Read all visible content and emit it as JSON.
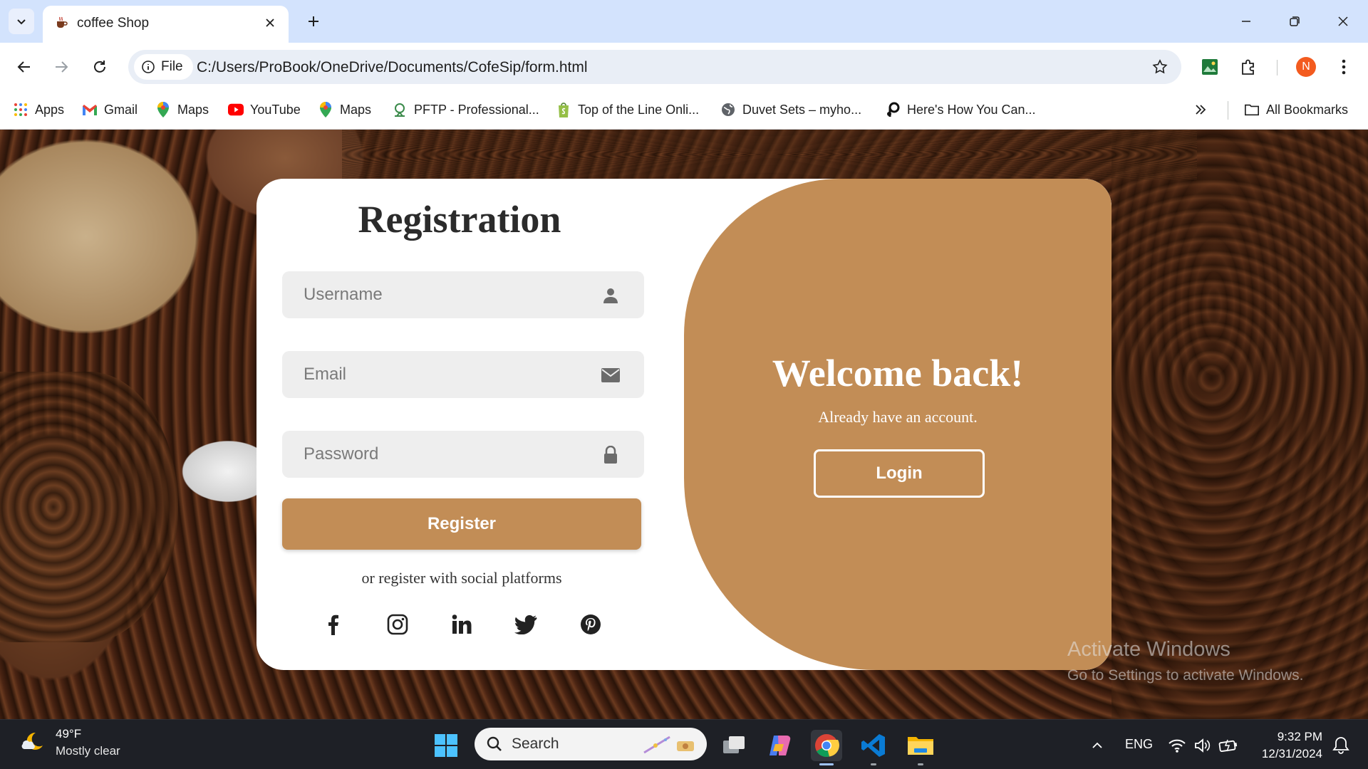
{
  "browser": {
    "tab": {
      "title": "coffee Shop"
    },
    "address": {
      "chip_label": "File",
      "url": "C:/Users/ProBook/OneDrive/Documents/CofeSip/form.html"
    },
    "profile_initial": "N",
    "bookmarks": [
      {
        "label": "Apps",
        "icon": "apps-grid-icon"
      },
      {
        "label": "Gmail",
        "icon": "gmail-icon"
      },
      {
        "label": "Maps",
        "icon": "maps-pin-icon"
      },
      {
        "label": "YouTube",
        "icon": "youtube-icon"
      },
      {
        "label": "Maps",
        "icon": "maps-pin-icon"
      },
      {
        "label": "PFTP - Professional...",
        "icon": "pftp-icon"
      },
      {
        "label": "Top of the Line Onli...",
        "icon": "shopify-bag-icon"
      },
      {
        "label": "Duvet Sets – myho...",
        "icon": "globe-icon"
      },
      {
        "label": "Here's How You Can...",
        "icon": "p-logo-icon"
      }
    ],
    "all_bookmarks": "All Bookmarks"
  },
  "form": {
    "title": "Registration",
    "username_placeholder": "Username",
    "email_placeholder": "Email",
    "password_placeholder": "Password",
    "register_label": "Register",
    "social_text": "or register with social platforms",
    "socials": [
      "facebook-icon",
      "instagram-icon",
      "linkedin-icon",
      "twitter-icon",
      "pinterest-icon"
    ]
  },
  "panel": {
    "welcome": "Welcome back!",
    "subtitle": "Already have an account.",
    "login_label": "Login"
  },
  "watermark": {
    "line1": "Activate Windows",
    "line2": "Go to Settings to activate Windows."
  },
  "taskbar": {
    "weather_temp": "49°F",
    "weather_cond": "Mostly clear",
    "search_label": "Search",
    "language": "ENG",
    "time": "9:32 PM",
    "date": "12/31/2024"
  },
  "colors": {
    "accent": "#c28d56",
    "chrome_tab_bg": "#d3e3fd",
    "taskbar_bg": "#1e2026"
  }
}
